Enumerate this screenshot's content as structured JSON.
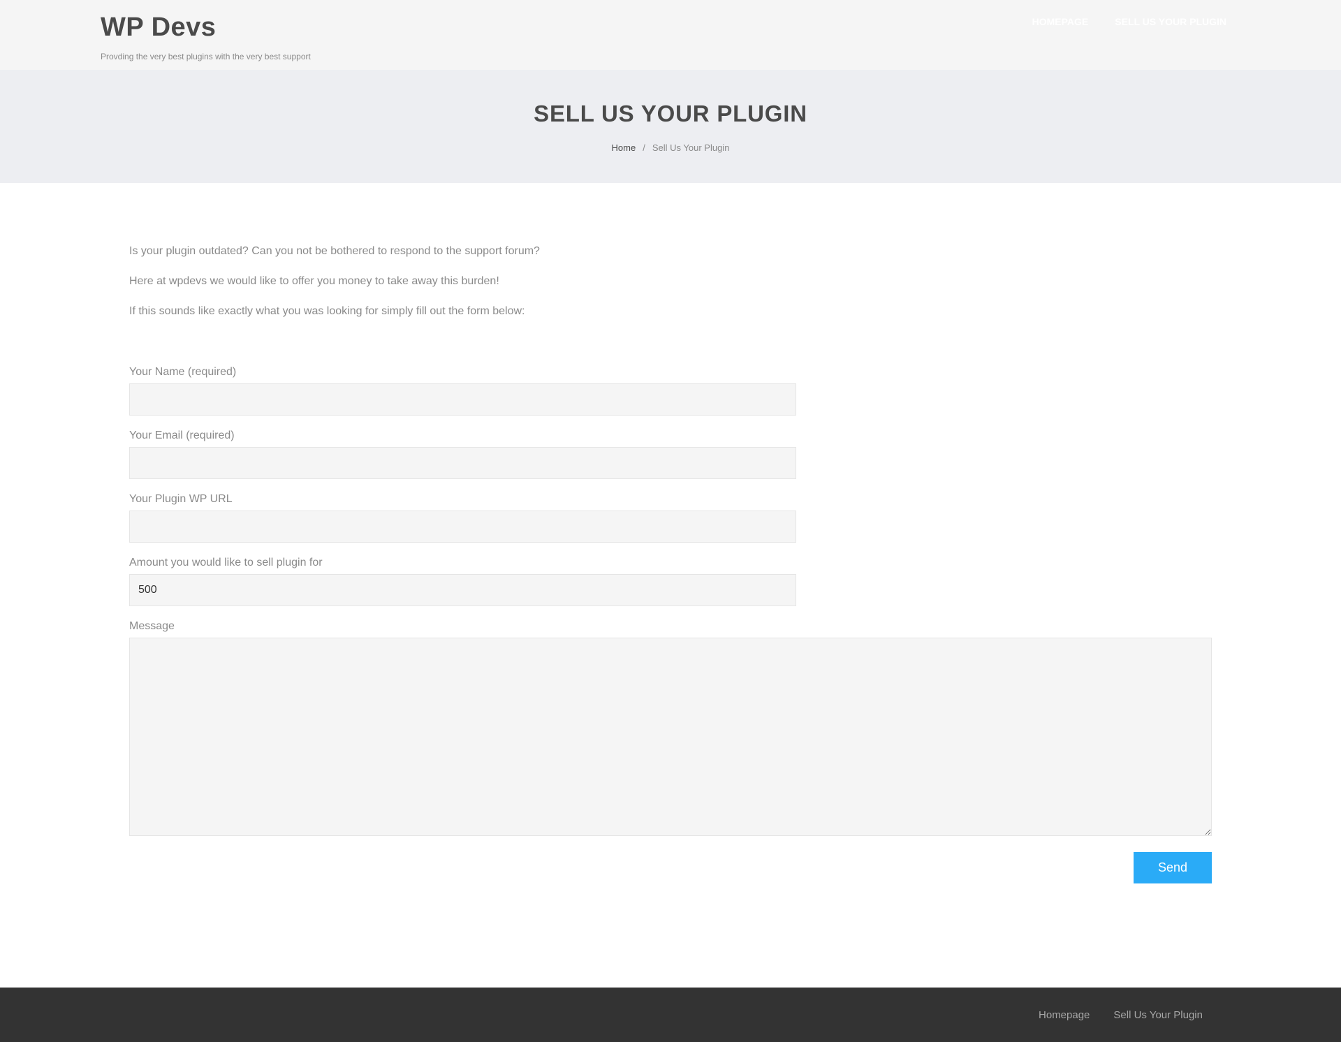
{
  "header": {
    "site_title": "WP Devs",
    "tagline": "Provding the very best plugins with the very best support",
    "nav": [
      {
        "label": "HOMEPAGE"
      },
      {
        "label": "SELL US YOUR PLUGIN"
      }
    ]
  },
  "banner": {
    "title": "SELL US YOUR PLUGIN",
    "breadcrumb": {
      "home": "Home",
      "separator": "/",
      "current": "Sell Us Your Plugin"
    }
  },
  "intro": {
    "paragraphs": [
      "Is your plugin outdated? Can you not be bothered to respond to the support forum?",
      "Here at wpdevs we would like to offer you money to take away this burden!",
      "If this sounds like exactly what you was looking for simply fill out the form below:"
    ]
  },
  "form": {
    "name": {
      "label": "Your Name (required)",
      "value": ""
    },
    "email": {
      "label": "Your Email (required)",
      "value": ""
    },
    "plugin_url": {
      "label": "Your Plugin WP URL",
      "value": ""
    },
    "amount": {
      "label": "Amount you would like to sell plugin for",
      "value": "500"
    },
    "message": {
      "label": "Message",
      "value": ""
    },
    "submit_label": "Send"
  },
  "footer": {
    "nav": [
      {
        "label": "Homepage"
      },
      {
        "label": "Sell Us Your Plugin"
      }
    ]
  },
  "colors": {
    "header_bg": "#f5f5f5",
    "banner_bg": "#edeef2",
    "accent": "#2aabf7",
    "footer_bg": "#333333",
    "text_dark": "#4a4a4a",
    "text_muted": "#8a8a8a"
  }
}
